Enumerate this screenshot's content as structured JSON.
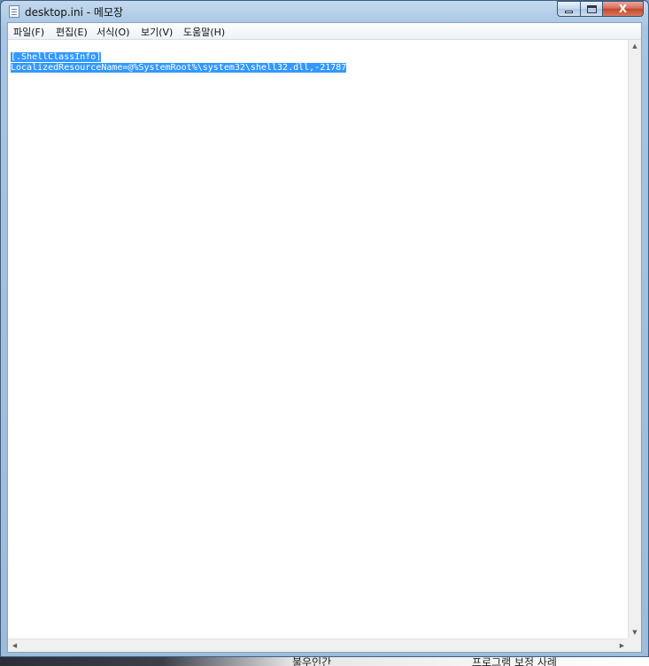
{
  "window": {
    "title": "desktop.ini - 메모장",
    "min_glyph": "",
    "max_glyph": "",
    "close_glyph": "X"
  },
  "menu": {
    "items": [
      "파일(F)",
      "편집(E)",
      "서식(O)",
      "보기(V)",
      "도움말(H)"
    ]
  },
  "editor": {
    "lines": [
      "[.ShellClassInfo]",
      "LocalizedResourceName=@%SystemRoot%\\system32\\shell32.dll,-21787"
    ],
    "selected": true
  },
  "scrollbars": {
    "up": "▲",
    "down": "▼",
    "left": "◀",
    "right": "▶"
  },
  "background_fragments": {
    "bottom_text_1": "불우인간",
    "bottom_text_2": "프로그램 보정 사례"
  },
  "colors": {
    "selection": "#3399ff",
    "frame": "#a7c5e3",
    "close": "#c4462d"
  }
}
